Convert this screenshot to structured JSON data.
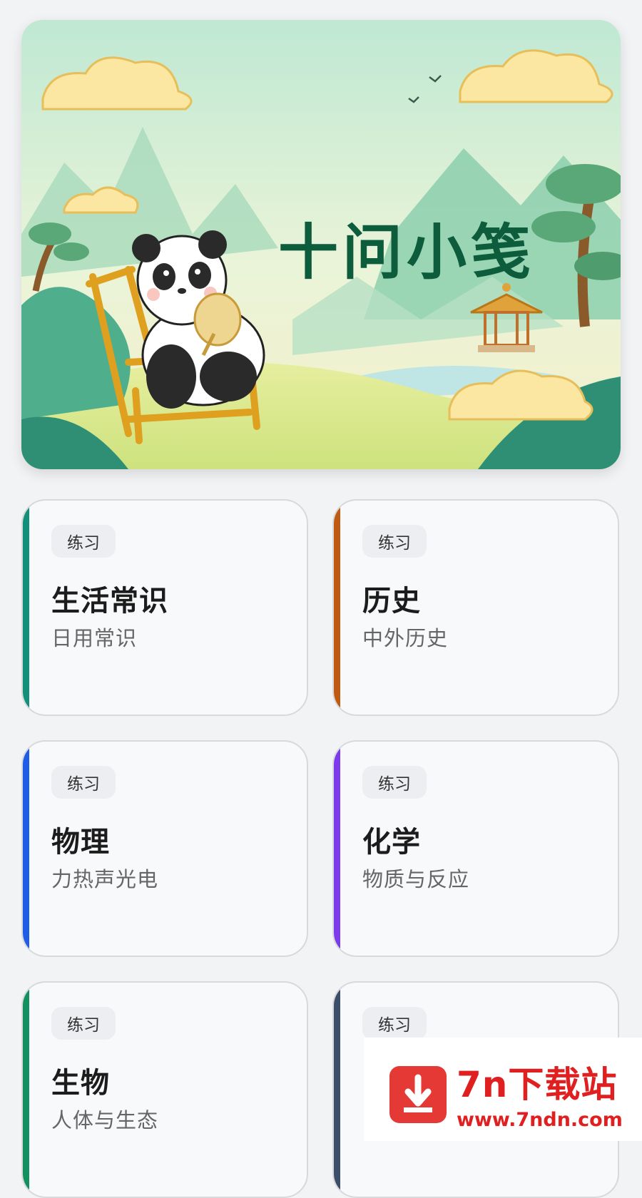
{
  "banner": {
    "title": "十问小笺"
  },
  "cards": [
    {
      "tag": "练习",
      "title": "生活常识",
      "subtitle": "日用常识",
      "accent": "#12907a"
    },
    {
      "tag": "练习",
      "title": "历史",
      "subtitle": "中外历史",
      "accent": "#c05a12"
    },
    {
      "tag": "练习",
      "title": "物理",
      "subtitle": "力热声光电",
      "accent": "#1f5de6"
    },
    {
      "tag": "练习",
      "title": "化学",
      "subtitle": "物质与反应",
      "accent": "#7c3aed"
    },
    {
      "tag": "练习",
      "title": "生物",
      "subtitle": "人体与生态",
      "accent": "#12905f"
    },
    {
      "tag": "练习",
      "title": "",
      "subtitle": "",
      "accent": "#3d4e6a"
    }
  ],
  "watermark": {
    "title": "7n下载站",
    "url": "www.7ndn.com"
  }
}
